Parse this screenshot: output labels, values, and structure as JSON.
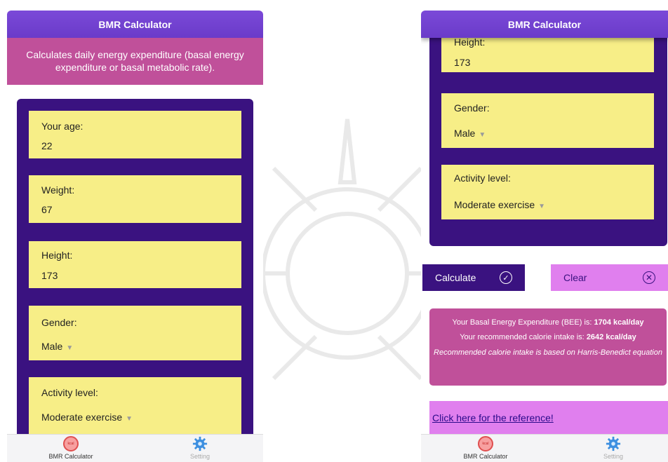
{
  "app": {
    "title": "BMR Calculator"
  },
  "description": "Calculates daily energy expenditure (basal energy expenditure or basal metabolic rate).",
  "form": {
    "age_label": "Your age:",
    "age_value": "22",
    "weight_label": "Weight:",
    "weight_value": "67",
    "height_label": "Height:",
    "height_value": "173",
    "gender_label": "Gender:",
    "gender_value": "Male",
    "activity_label": "Activity level:",
    "activity_value": "Moderate exercise"
  },
  "buttons": {
    "calculate": "Calculate",
    "clear": "Clear"
  },
  "result": {
    "bee_prefix": "Your Basal Energy Expenditure (BEE) is:",
    "bee_value": "1704 kcal/day",
    "intake_prefix": "Your recommended calorie intake is:",
    "intake_value": "2642 kcal/day",
    "note": "Recommended calorie intake is based on Harris-Benedict equation"
  },
  "reference_link": "Click here for the reference!",
  "tabs": [
    {
      "label": "BMR Calculator",
      "icon": "kcal-icon"
    },
    {
      "label": "Setting",
      "icon": "gear-icon"
    }
  ],
  "colors": {
    "header": "#7b49d8",
    "description_bg": "#c0509a",
    "form_bg": "#3a1280",
    "field_bg": "#f7ee87",
    "clear_bg": "#e07fee"
  }
}
